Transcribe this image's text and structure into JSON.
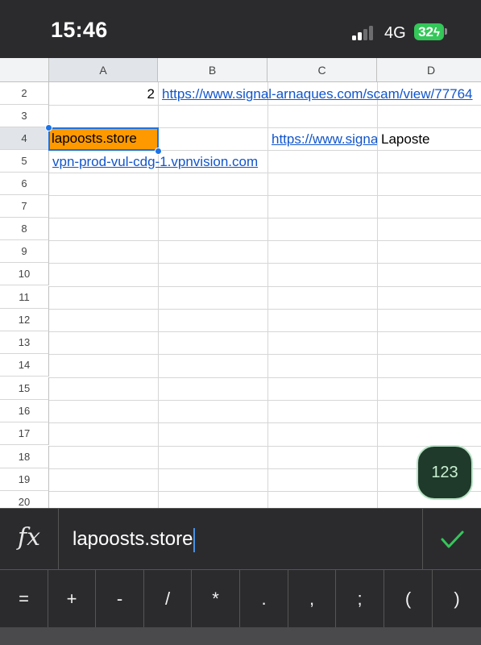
{
  "status_bar": {
    "time": "15:46",
    "network": "4G",
    "battery": "32"
  },
  "sheet": {
    "columns": [
      "A",
      "B",
      "C",
      "D"
    ],
    "rows": [
      "2",
      "3",
      "4",
      "5",
      "6",
      "7",
      "8",
      "9",
      "10",
      "11",
      "12",
      "13",
      "14",
      "15",
      "16",
      "17",
      "18",
      "19",
      "20"
    ],
    "cells": {
      "A2": "2",
      "B2": "https://www.signal-arnaques.com/scam/view/77764",
      "A4": "lapoosts.store",
      "C4": "https://www.signal-arnaques.com",
      "D4": "Laposte",
      "A5": "vpn-prod-vul-cdg-1.vpnvision.com"
    },
    "selected_cell": "A4",
    "selected_fill": "#ff9900",
    "link_color": "#1155cc",
    "selection_color": "#1a73e8"
  },
  "fab": {
    "label": "123"
  },
  "formula_bar": {
    "fx_label": "fx",
    "value": "lapoosts.store",
    "confirm_icon": "checkmark-icon",
    "confirm_color": "#34c759"
  },
  "keys": [
    "=",
    "+",
    "-",
    "/",
    "*",
    ".",
    ",",
    ";",
    "(",
    ")"
  ]
}
